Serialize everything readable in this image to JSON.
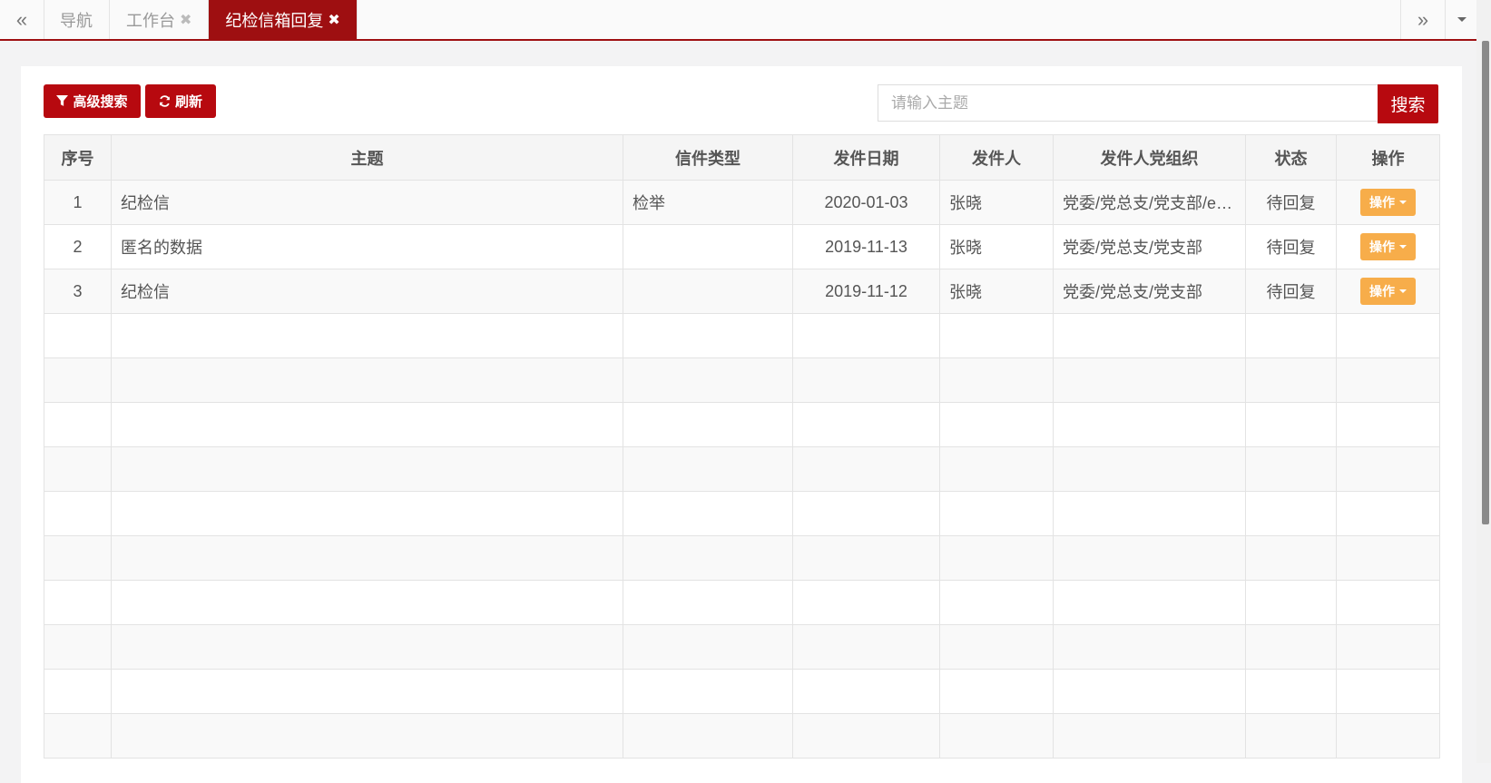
{
  "tabbar": {
    "prev_glyph": "«",
    "next_glyph": "»",
    "tabs": [
      {
        "label": "导航",
        "closable": false
      },
      {
        "label": "工作台",
        "closable": true
      },
      {
        "label": "纪检信箱回复",
        "closable": true,
        "active": true
      }
    ],
    "close_glyph": "✖"
  },
  "toolbar": {
    "advanced_search_label": "高级搜索",
    "refresh_label": "刷新",
    "search_placeholder": "请输入主题",
    "search_button_label": "搜索"
  },
  "table": {
    "columns": [
      "序号",
      "主题",
      "信件类型",
      "发件日期",
      "发件人",
      "发件人党组织",
      "状态",
      "操作"
    ],
    "rows": [
      {
        "index": "1",
        "subject": "纪检信",
        "type": "检举",
        "date": "2020-01-03",
        "sender": "张晓",
        "org": "党委/党总支/党支部/e…",
        "status": "待回复",
        "action": "操作"
      },
      {
        "index": "2",
        "subject": "匿名的数据",
        "type": "",
        "date": "2019-11-13",
        "sender": "张晓",
        "org": "党委/党总支/党支部",
        "status": "待回复",
        "action": "操作"
      },
      {
        "index": "3",
        "subject": "纪检信",
        "type": "",
        "date": "2019-11-12",
        "sender": "张晓",
        "org": "党委/党总支/党支部",
        "status": "待回复",
        "action": "操作"
      }
    ]
  },
  "colors": {
    "brand_red": "#b7090f",
    "tab_active": "#9e0f11",
    "action_orange": "#f7ad4a"
  }
}
